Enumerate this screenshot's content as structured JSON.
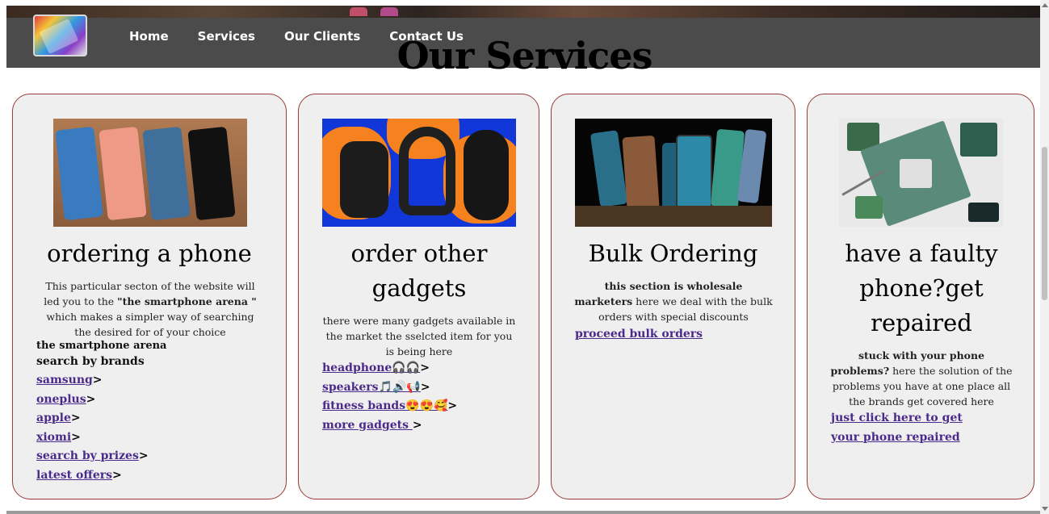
{
  "nav": {
    "items": [
      "Home",
      "Services",
      "Our Clients",
      "Contact Us"
    ]
  },
  "page_title": "Our Services",
  "cards": [
    {
      "title": "ordering a phone",
      "desc_pre": "This particular secton of the website will led you to the ",
      "desc_bold": "\"the smartphone arena \"",
      "desc_post": " which makes a simpler way of searching the desired for of your choice",
      "sub1": "the smartphone arena",
      "sub2": "search by brands",
      "links": [
        "samsung",
        "oneplus",
        "apple",
        "xiomi",
        "search by prizes",
        "latest offers"
      ]
    },
    {
      "title": "order other gadgets",
      "desc": "there were many gadgets available in the market the sselcted item for you is being here",
      "links": [
        "headphone🎧🎧",
        "speakers🎵🔊📢",
        "fitness bands😍😍🥰",
        "more gadgets "
      ]
    },
    {
      "title": "Bulk Ordering",
      "desc_bold": "this section is wholesale marketers",
      "desc_post": " here we deal with the bulk orders with special discounts",
      "link": "proceed bulk orders"
    },
    {
      "title": "have a faulty phone?get repaired",
      "desc_bold": "stuck with your phone problems?",
      "desc_post": " here the solution of the problems you have at one place all the brands get covered here",
      "link": "just click here to get your phone repaired"
    }
  ],
  "gt": ">",
  "colors": {
    "nav_bg": "#4b4b4b",
    "card_border": "#9b3a3a",
    "link": "#4a2a8a",
    "card_bg": "#efefef"
  }
}
